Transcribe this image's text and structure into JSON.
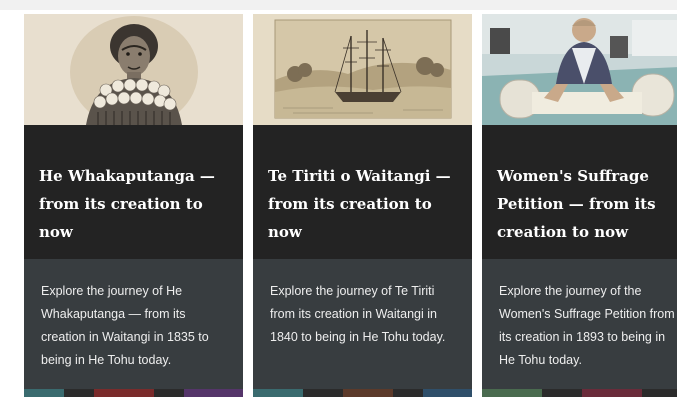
{
  "cards": [
    {
      "title": "He Whakaputanga — from its creation to now",
      "description": "Explore the journey of He Whakaputanga — from its creation in Waitangi in 1835 to being in He Tohu today.",
      "image_icon": "portrait-engraving-icon"
    },
    {
      "title": "Te Tiriti o Waitangi — from its creation to now",
      "description": "Explore the journey of Te Tiriti from its creation in Waitangi in 1840 to being in He Tohu today.",
      "image_icon": "ship-engraving-icon"
    },
    {
      "title": "Women's Suffrage Petition — from its creation to now",
      "description": "Explore the journey of the Women's Suffrage Petition from its creation in 1893 to being in He Tohu today.",
      "image_icon": "conservator-photo-icon"
    }
  ],
  "colors": {
    "card_header_bg": "#232323",
    "card_body_bg": "#383d40",
    "title_text": "#ffffff",
    "body_text": "#eeeeee"
  }
}
